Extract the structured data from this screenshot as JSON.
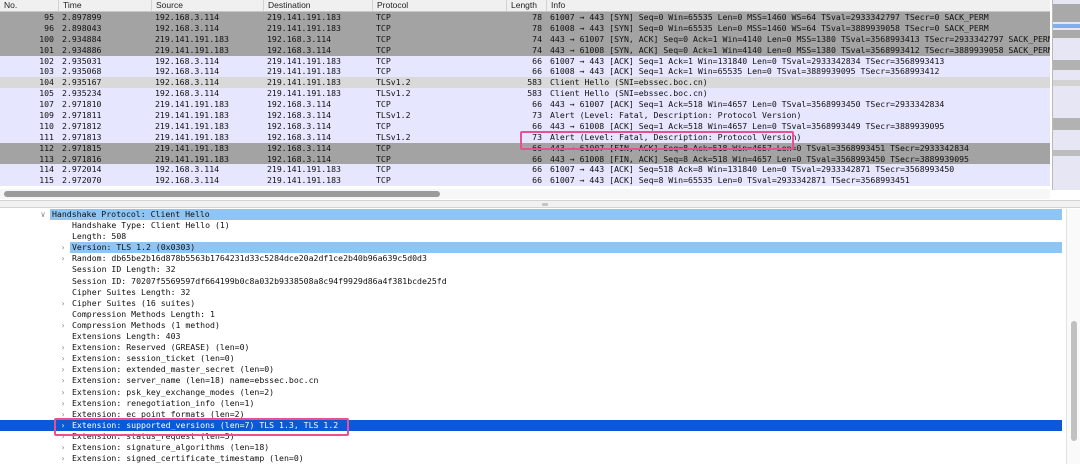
{
  "packet_list": {
    "columns": [
      "No.",
      "Time",
      "Source",
      "Destination",
      "Protocol",
      "Length",
      "Info"
    ],
    "rows": [
      {
        "no": "95",
        "time": "2.897899",
        "src": "192.168.3.114",
        "dst": "219.141.191.183",
        "proto": "TCP",
        "len": "78",
        "info": "61007 → 443 [SYN] Seq=0 Win=65535 Len=0 MSS=1460 WS=64 TSval=2933342797 TSecr=0 SACK_PERM",
        "bg": "#a3a3a3",
        "fg": "#111111"
      },
      {
        "no": "96",
        "time": "2.898043",
        "src": "192.168.3.114",
        "dst": "219.141.191.183",
        "proto": "TCP",
        "len": "78",
        "info": "61008 → 443 [SYN] Seq=0 Win=65535 Len=0 MSS=1460 WS=64 TSval=3889939058 TSecr=0 SACK_PERM",
        "bg": "#a3a3a3",
        "fg": "#111111"
      },
      {
        "no": "100",
        "time": "2.934884",
        "src": "219.141.191.183",
        "dst": "192.168.3.114",
        "proto": "TCP",
        "len": "74",
        "info": "443 → 61007 [SYN, ACK] Seq=0 Ack=1 Win=4140 Len=0 MSS=1380 TSval=3568993413 TSecr=2933342797 SACK_PERM",
        "bg": "#a3a3a3",
        "fg": "#111111"
      },
      {
        "no": "101",
        "time": "2.934886",
        "src": "219.141.191.183",
        "dst": "192.168.3.114",
        "proto": "TCP",
        "len": "74",
        "info": "443 → 61008 [SYN, ACK] Seq=0 Ack=1 Win=4140 Len=0 MSS=1380 TSval=3568993412 TSecr=3889939058 SACK_PERM",
        "bg": "#a3a3a3",
        "fg": "#111111"
      },
      {
        "no": "102",
        "time": "2.935031",
        "src": "192.168.3.114",
        "dst": "219.141.191.183",
        "proto": "TCP",
        "len": "66",
        "info": "61007 → 443 [ACK] Seq=1 Ack=1 Win=131840 Len=0 TSval=2933342834 TSecr=3568993413",
        "bg": "#e7e6ff",
        "fg": "#111111"
      },
      {
        "no": "103",
        "time": "2.935068",
        "src": "192.168.3.114",
        "dst": "219.141.191.183",
        "proto": "TCP",
        "len": "66",
        "info": "61008 → 443 [ACK] Seq=1 Ack=1 Win=65535 Len=0 TSval=3889939095 TSecr=3568993412",
        "bg": "#e7e6ff",
        "fg": "#111111"
      },
      {
        "no": "104",
        "time": "2.935167",
        "src": "192.168.3.114",
        "dst": "219.141.191.183",
        "proto": "TLSv1.2",
        "len": "583",
        "info": "Client Hello (SNI=ebssec.boc.cn)",
        "bg": "#d9d9d9",
        "fg": "#111111"
      },
      {
        "no": "105",
        "time": "2.935234",
        "src": "192.168.3.114",
        "dst": "219.141.191.183",
        "proto": "TLSv1.2",
        "len": "583",
        "info": "Client Hello (SNI=ebssec.boc.cn)",
        "bg": "#e7e6ff",
        "fg": "#111111"
      },
      {
        "no": "107",
        "time": "2.971810",
        "src": "219.141.191.183",
        "dst": "192.168.3.114",
        "proto": "TCP",
        "len": "66",
        "info": "443 → 61007 [ACK] Seq=1 Ack=518 Win=4657 Len=0 TSval=3568993450 TSecr=2933342834",
        "bg": "#e7e6ff",
        "fg": "#111111"
      },
      {
        "no": "109",
        "time": "2.971811",
        "src": "219.141.191.183",
        "dst": "192.168.3.114",
        "proto": "TLSv1.2",
        "len": "73",
        "info": "Alert (Level: Fatal, Description: Protocol Version)",
        "bg": "#e7e6ff",
        "fg": "#111111"
      },
      {
        "no": "110",
        "time": "2.971812",
        "src": "219.141.191.183",
        "dst": "192.168.3.114",
        "proto": "TCP",
        "len": "66",
        "info": "443 → 61008 [ACK] Seq=1 Ack=518 Win=4657 Len=0 TSval=3568993449 TSecr=3889939095",
        "bg": "#e7e6ff",
        "fg": "#111111"
      },
      {
        "no": "111",
        "time": "2.971813",
        "src": "219.141.191.183",
        "dst": "192.168.3.114",
        "proto": "TLSv1.2",
        "len": "73",
        "info": "Alert (Level: Fatal, Description: Protocol Version)",
        "bg": "#e7e6ff",
        "fg": "#111111"
      },
      {
        "no": "112",
        "time": "2.971815",
        "src": "219.141.191.183",
        "dst": "192.168.3.114",
        "proto": "TCP",
        "len": "66",
        "info": "443 → 61007 [FIN, ACK] Seq=8 Ack=518 Win=4657 Len=0 TSval=3568993451 TSecr=2933342834",
        "bg": "#a3a3a3",
        "fg": "#111111"
      },
      {
        "no": "113",
        "time": "2.971816",
        "src": "219.141.191.183",
        "dst": "192.168.3.114",
        "proto": "TCP",
        "len": "66",
        "info": "443 → 61008 [FIN, ACK] Seq=8 Ack=518 Win=4657 Len=0 TSval=3568993450 TSecr=3889939095",
        "bg": "#a3a3a3",
        "fg": "#111111"
      },
      {
        "no": "114",
        "time": "2.972014",
        "src": "192.168.3.114",
        "dst": "219.141.191.183",
        "proto": "TCP",
        "len": "66",
        "info": "61007 → 443 [ACK] Seq=518 Ack=8 Win=131840 Len=0 TSval=2933342871 TSecr=3568993450",
        "bg": "#e7e6ff",
        "fg": "#111111"
      },
      {
        "no": "115",
        "time": "2.972070",
        "src": "192.168.3.114",
        "dst": "219.141.191.183",
        "proto": "TCP",
        "len": "66",
        "info": "61007 → 443 [ACK] Seq=8 Win=65535 Len=0 TSval=2933342871 TSecr=3568993451",
        "bg": "#e7e6ff",
        "fg": "#111111"
      }
    ]
  },
  "details": {
    "rows": [
      {
        "text": "Handshake Protocol: Client Hello",
        "indent": 1,
        "arrow": "v",
        "sel": "light"
      },
      {
        "text": "Handshake Type: Client Hello (1)",
        "indent": 2,
        "arrow": "",
        "sel": ""
      },
      {
        "text": "Length: 508",
        "indent": 2,
        "arrow": "",
        "sel": ""
      },
      {
        "text": "Version: TLS 1.2 (0x0303)",
        "indent": 2,
        "arrow": ">",
        "sel": "light"
      },
      {
        "text": "Random: db65be2b16d878b5563b1764231d33c5284dce20a2df1ce2b40b96a639c5d0d3",
        "indent": 2,
        "arrow": ">",
        "sel": ""
      },
      {
        "text": "Session ID Length: 32",
        "indent": 2,
        "arrow": "",
        "sel": ""
      },
      {
        "text": "Session ID: 70207f5569597df664199b0c8a032b9338508a8c94f9929d86a4f381bcde25fd",
        "indent": 2,
        "arrow": "",
        "sel": ""
      },
      {
        "text": "Cipher Suites Length: 32",
        "indent": 2,
        "arrow": "",
        "sel": ""
      },
      {
        "text": "Cipher Suites (16 suites)",
        "indent": 2,
        "arrow": ">",
        "sel": ""
      },
      {
        "text": "Compression Methods Length: 1",
        "indent": 2,
        "arrow": "",
        "sel": ""
      },
      {
        "text": "Compression Methods (1 method)",
        "indent": 2,
        "arrow": ">",
        "sel": ""
      },
      {
        "text": "Extensions Length: 403",
        "indent": 2,
        "arrow": "",
        "sel": ""
      },
      {
        "text": "Extension: Reserved (GREASE) (len=0)",
        "indent": 2,
        "arrow": ">",
        "sel": ""
      },
      {
        "text": "Extension: session_ticket (len=0)",
        "indent": 2,
        "arrow": ">",
        "sel": ""
      },
      {
        "text": "Extension: extended_master_secret (len=0)",
        "indent": 2,
        "arrow": ">",
        "sel": ""
      },
      {
        "text": "Extension: server_name (len=18) name=ebssec.boc.cn",
        "indent": 2,
        "arrow": ">",
        "sel": ""
      },
      {
        "text": "Extension: psk_key_exchange_modes (len=2)",
        "indent": 2,
        "arrow": ">",
        "sel": ""
      },
      {
        "text": "Extension: renegotiation_info (len=1)",
        "indent": 2,
        "arrow": ">",
        "sel": ""
      },
      {
        "text": "Extension: ec_point_formats (len=2)",
        "indent": 2,
        "arrow": ">",
        "sel": ""
      },
      {
        "text": "Extension: supported_versions (len=7) TLS 1.3, TLS 1.2",
        "indent": 2,
        "arrow": ">",
        "sel": "dark"
      },
      {
        "text": "Extension: status_request (len=5)",
        "indent": 2,
        "arrow": ">",
        "sel": ""
      },
      {
        "text": "Extension: signature_algorithms (len=18)",
        "indent": 2,
        "arrow": ">",
        "sel": ""
      },
      {
        "text": "Extension: signed_certificate_timestamp (len=0)",
        "indent": 2,
        "arrow": ">",
        "sel": ""
      }
    ]
  },
  "colors": {
    "selected_dark": "#0a5ad8",
    "selected_light": "#8ec5f4",
    "highlight_box": "#e8508f",
    "gray_row": "#a3a3a3",
    "lavender_row": "#e7e6ff"
  },
  "icons": {
    "expand": "chevron-right-icon",
    "collapse": "chevron-down-icon"
  }
}
